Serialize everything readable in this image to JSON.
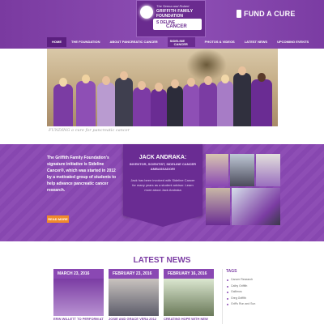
{
  "brand": {
    "logo_small": "The Seena and Robert",
    "logo_line1": "GRIFFITH FAMILY",
    "logo_line2": "FOUNDATION",
    "badge_line1": "S DELINE",
    "badge_line2": "CANCER",
    "fund_label": "FUND A CURE"
  },
  "nav": {
    "items": [
      {
        "label": "HOME",
        "active": true
      },
      {
        "label": "THE FOUNDATION"
      },
      {
        "label": "ABOUT PANCREATIC CANCER"
      },
      {
        "label": "PHOTOS & VIDEOS"
      },
      {
        "label": "LATEST NEWS"
      },
      {
        "label": "UPCOMING EVENTS"
      }
    ],
    "center_logo_1": "SIDELINE",
    "center_logo_2": "CANCER"
  },
  "hero": {
    "tagline": "FUNDING a cure for pancreatic cancer"
  },
  "band": {
    "intro": "The Griffith Family Foundation's signature initiative is Sideline Cancer®, which was started in 2012 by a motivated group of students to help advance pancreatic cancer research.",
    "read_more": "READ MORE",
    "card_title": "JACK ANDRAKA:",
    "card_sub": "INVENTOR, SCIENTIST, SIDELINE CANCER AMBASSADOR!",
    "card_body": "Jack has been involved with Sideline Cancer for many years as a student advisor. Learn more about Jack Andraka"
  },
  "news": {
    "title": "LATEST NEWS",
    "items": [
      {
        "date": "MARCH 23, 2016",
        "caption": "ERIN WILLETT TO PERFORM AT"
      },
      {
        "date": "FEBRUARY 23, 2016",
        "caption": "JOSIE AND GRACE VERA 2012"
      },
      {
        "date": "FEBRUARY 16, 2016",
        "caption": "CREATING HOPE WITH NEW"
      }
    ]
  },
  "tags": {
    "title": "TAGS",
    "items": [
      "Cancer Research",
      "Cathy Griffith",
      "Gallimos",
      "Greg Griffith",
      "Griff's Run and Sun"
    ]
  },
  "colors": {
    "primary": "#8a48b3",
    "dark": "#6a2c93",
    "accent": "#f08a2b"
  }
}
